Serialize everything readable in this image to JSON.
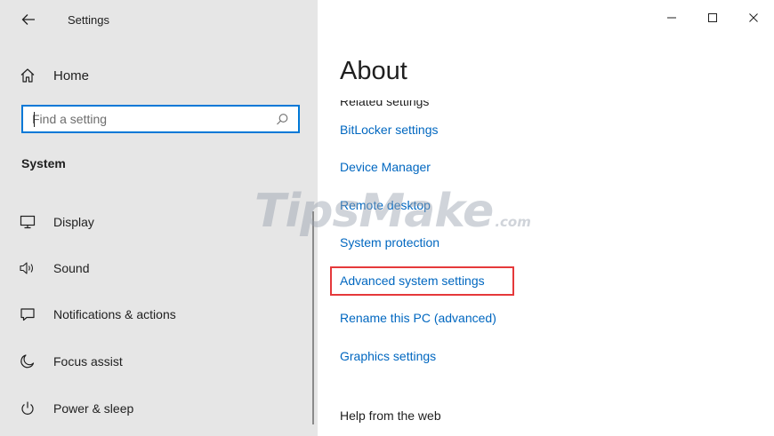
{
  "window": {
    "app_title": "Settings",
    "controls": {
      "minimize_icon": "minimize-icon",
      "maximize_icon": "maximize-icon",
      "close_icon": "close-icon"
    }
  },
  "sidebar": {
    "back_icon": "back-arrow-icon",
    "home": {
      "label": "Home",
      "icon": "home-icon"
    },
    "search": {
      "placeholder": "Find a setting",
      "value": "",
      "icon": "search-icon"
    },
    "section_title": "System",
    "items": [
      {
        "label": "Display",
        "icon": "display-icon"
      },
      {
        "label": "Sound",
        "icon": "sound-icon"
      },
      {
        "label": "Notifications & actions",
        "icon": "notifications-icon"
      },
      {
        "label": "Focus assist",
        "icon": "focus-assist-icon"
      },
      {
        "label": "Power & sleep",
        "icon": "power-icon"
      }
    ]
  },
  "main": {
    "heading": "About",
    "related_settings_heading": "Related settings",
    "links": [
      "BitLocker settings",
      "Device Manager",
      "Remote desktop",
      "System protection",
      "Advanced system settings",
      "Rename this PC (advanced)",
      "Graphics settings"
    ],
    "highlighted_link": "Advanced system settings",
    "help_heading": "Help from the web"
  },
  "watermark": {
    "brand": "TipsMake",
    "domain": ".com"
  },
  "colors": {
    "sidebar_bg": "#e6e6e6",
    "link": "#0067c0",
    "accent": "#0078d7",
    "highlight": "#e5393b"
  }
}
